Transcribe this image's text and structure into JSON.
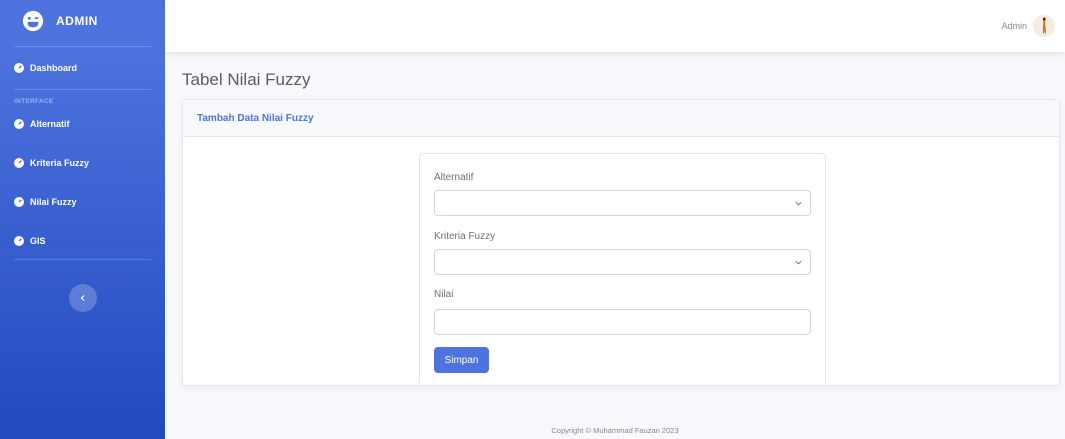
{
  "sidebar": {
    "brand": "ADMIN",
    "dashboard": "Dashboard",
    "heading": "INTERFACE",
    "items": [
      {
        "label": "Alternatif",
        "icon": "tachometer-icon"
      },
      {
        "label": "Kriteria Fuzzy",
        "icon": "tachometer-icon"
      },
      {
        "label": "Nilai Fuzzy",
        "icon": "tachometer-icon"
      },
      {
        "label": "GIS",
        "icon": "tachometer-icon"
      }
    ],
    "toggle_icon": "chevron-left-icon"
  },
  "topbar": {
    "user_name": "Admin"
  },
  "page": {
    "title": "Tabel Nilai Fuzzy"
  },
  "card": {
    "header": "Tambah Data Nilai Fuzzy",
    "form": {
      "alternatif_label": "Alternatif",
      "alternatif_value": "",
      "kriteria_label": "Kriteria Fuzzy",
      "kriteria_value": "",
      "nilai_label": "Nilai",
      "nilai_value": "",
      "submit_label": "Simpan"
    }
  },
  "footer": {
    "copyright": "Copyright © Muhammad Fauzan 2023"
  },
  "colors": {
    "primary": "#4e73df",
    "sidebar_gradient_end": "#224abe"
  }
}
